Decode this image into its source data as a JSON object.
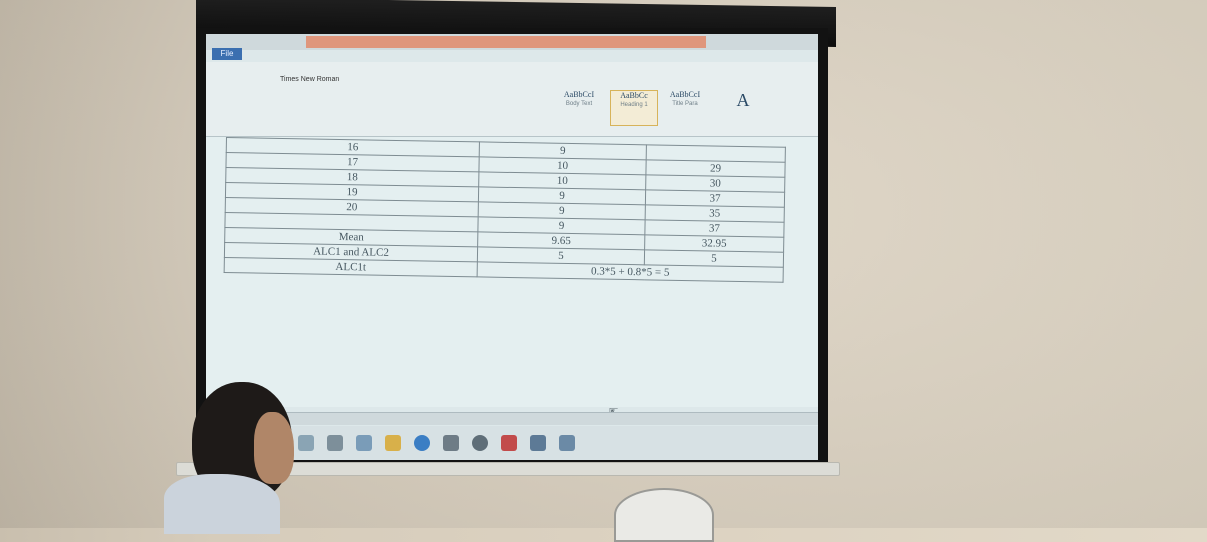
{
  "word_ui": {
    "file_tab": "File",
    "font_name": "Times New Roman",
    "styles": [
      {
        "preview": "AaBbCcI",
        "name": "Body Text",
        "selected": false
      },
      {
        "preview": "AaBbCc",
        "name": "Heading 1",
        "selected": true
      },
      {
        "preview": "AaBbCcI",
        "name": "Title Para",
        "selected": false
      }
    ]
  },
  "table": {
    "rows": [
      [
        "16",
        "9",
        ""
      ],
      [
        "17",
        "10",
        "29"
      ],
      [
        "18",
        "10",
        "30"
      ],
      [
        "19",
        "9",
        "37"
      ],
      [
        "20",
        "9",
        "35"
      ],
      [
        "",
        "9",
        "37"
      ],
      [
        "Mean",
        "9.65",
        "32.95"
      ],
      [
        "ALC1 and ALC2",
        "5",
        "5"
      ]
    ],
    "last_row": {
      "label": "ALC1t",
      "formula": "0.3*5 + 0.8*5 = 5"
    }
  }
}
